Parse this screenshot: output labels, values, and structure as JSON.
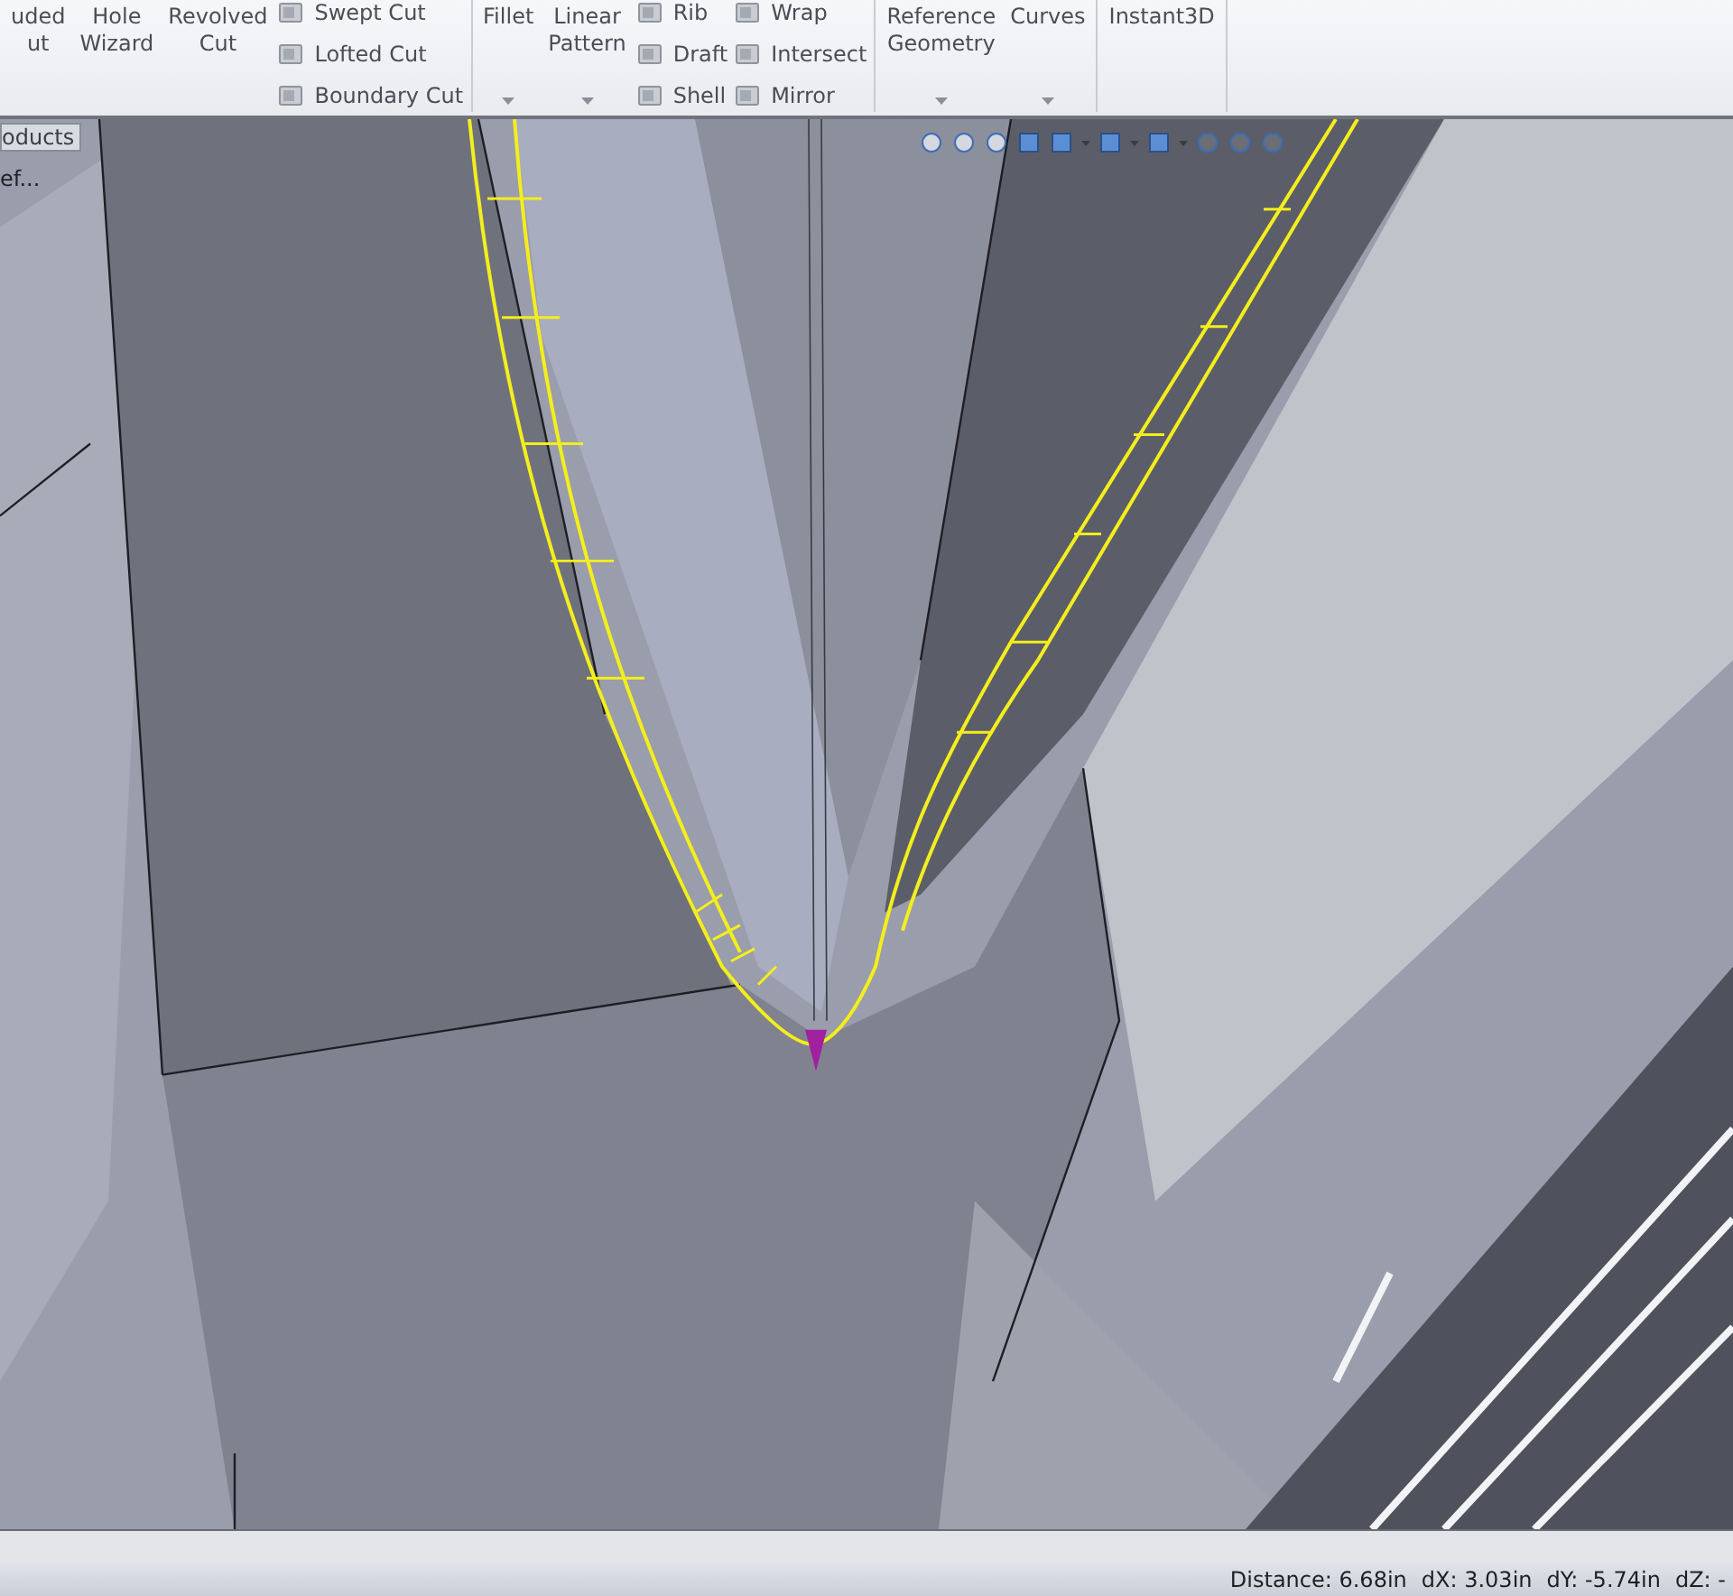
{
  "ribbon": {
    "groups": [
      {
        "items": [
          {
            "kind": "large",
            "lines": [
              "uded",
              "ut"
            ],
            "dropdown": false
          },
          {
            "kind": "large",
            "lines": [
              "Hole",
              "Wizard"
            ],
            "dropdown": false
          },
          {
            "kind": "large",
            "lines": [
              "Revolved",
              "Cut"
            ],
            "dropdown": false
          },
          {
            "kind": "stack",
            "labels": [
              "Swept Cut",
              "Lofted Cut",
              "Boundary Cut"
            ]
          }
        ]
      },
      {
        "items": [
          {
            "kind": "large",
            "lines": [
              "Fillet"
            ],
            "dropdown": true
          },
          {
            "kind": "large",
            "lines": [
              "Linear",
              "Pattern"
            ],
            "dropdown": true
          },
          {
            "kind": "stack",
            "labels": [
              "Rib",
              "Draft",
              "Shell"
            ]
          },
          {
            "kind": "stack",
            "labels": [
              "Wrap",
              "Intersect",
              "Mirror"
            ]
          }
        ]
      },
      {
        "items": [
          {
            "kind": "large",
            "lines": [
              "Reference",
              "Geometry"
            ],
            "dropdown": true
          },
          {
            "kind": "large",
            "lines": [
              "Curves"
            ],
            "dropdown": true
          }
        ]
      },
      {
        "items": [
          {
            "kind": "large",
            "lines": [
              "Instant3D"
            ],
            "dropdown": false
          }
        ]
      }
    ]
  },
  "viewport": {
    "tree_tab": "oducts",
    "tree_item": "ef..."
  },
  "status_bar": {
    "items": [
      "Distance: 6.68in",
      "dX: 3.03in",
      "dY: -5.74in",
      "dZ: -"
    ]
  }
}
